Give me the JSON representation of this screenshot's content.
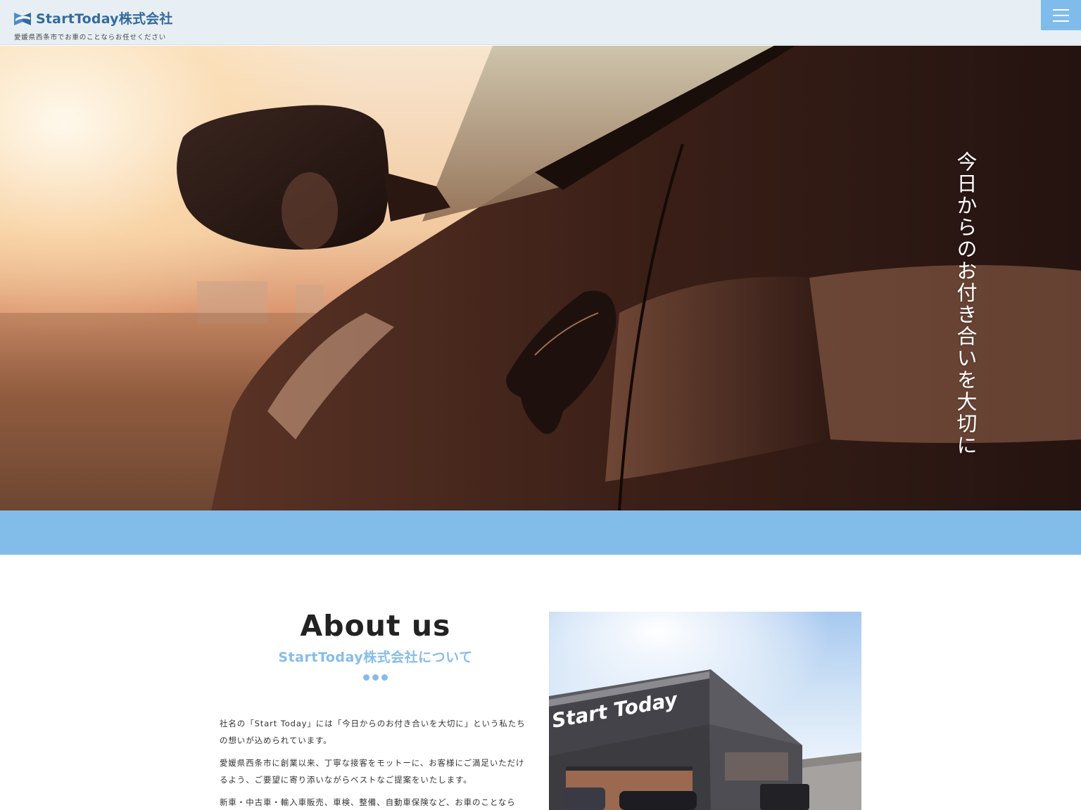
{
  "header": {
    "logo_text": "StartToday株式会社",
    "tagline": "愛媛県西条市でお車のことならお任せください",
    "menu_icon": "hamburger-icon"
  },
  "hero": {
    "tagline": "今日からのお付き合いを大切に"
  },
  "about": {
    "title": "About us",
    "subtitle": "StartToday株式会社について",
    "paragraphs": [
      "社名の「Start Today」には「今日からのお付き合いを大切に」という私たちの想いが込められています。",
      "愛媛県西条市に創業以来、丁寧な接客をモットーに、お客様にご満足いただけるよう、ご要望に寄り添いながらベストなご提案をいたします。",
      "新車・中古車・輸入車販売、車検、整備、自動車保険など、お車のことなら"
    ],
    "store_sign": "Start Today"
  },
  "colors": {
    "brand": "#346b9f",
    "accent": "#82bdea",
    "header_bg": "#e7eff4"
  }
}
